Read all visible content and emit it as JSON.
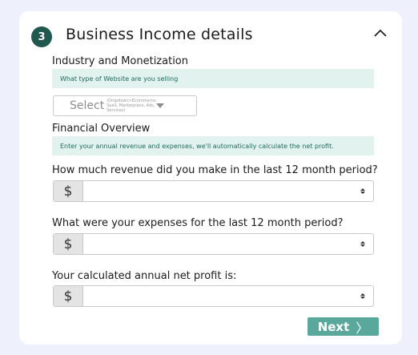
{
  "section": {
    "step_number": "3",
    "title": "Business Income details"
  },
  "industry": {
    "heading": "Industry and Monetization",
    "hint": "What type of Website are you selling",
    "select_label": "Select",
    "select_hint": "(Dropdown>Ecommerce, SaaS, Marketplace, Ads, Services)"
  },
  "financial": {
    "heading": "Financial Overview",
    "hint": "Enter your annual revenue and expenses, we'll automatically calculate the net profit."
  },
  "fields": {
    "revenue": {
      "question": "How much revenue did you make in the last 12 month period?",
      "prefix": "$",
      "value": ""
    },
    "expenses": {
      "question": "What were your expenses for the last 12 month period?",
      "prefix": "$",
      "value": ""
    },
    "net_profit": {
      "question": "Your calculated annual net profit is:",
      "prefix": "$",
      "value": ""
    }
  },
  "actions": {
    "next_label": "Next",
    "next_chevron": "〉"
  },
  "colors": {
    "accent": "#20574f",
    "button": "#5aa89b",
    "hint_bg": "#e2f2ee",
    "page_bg": "#eef1fb"
  }
}
